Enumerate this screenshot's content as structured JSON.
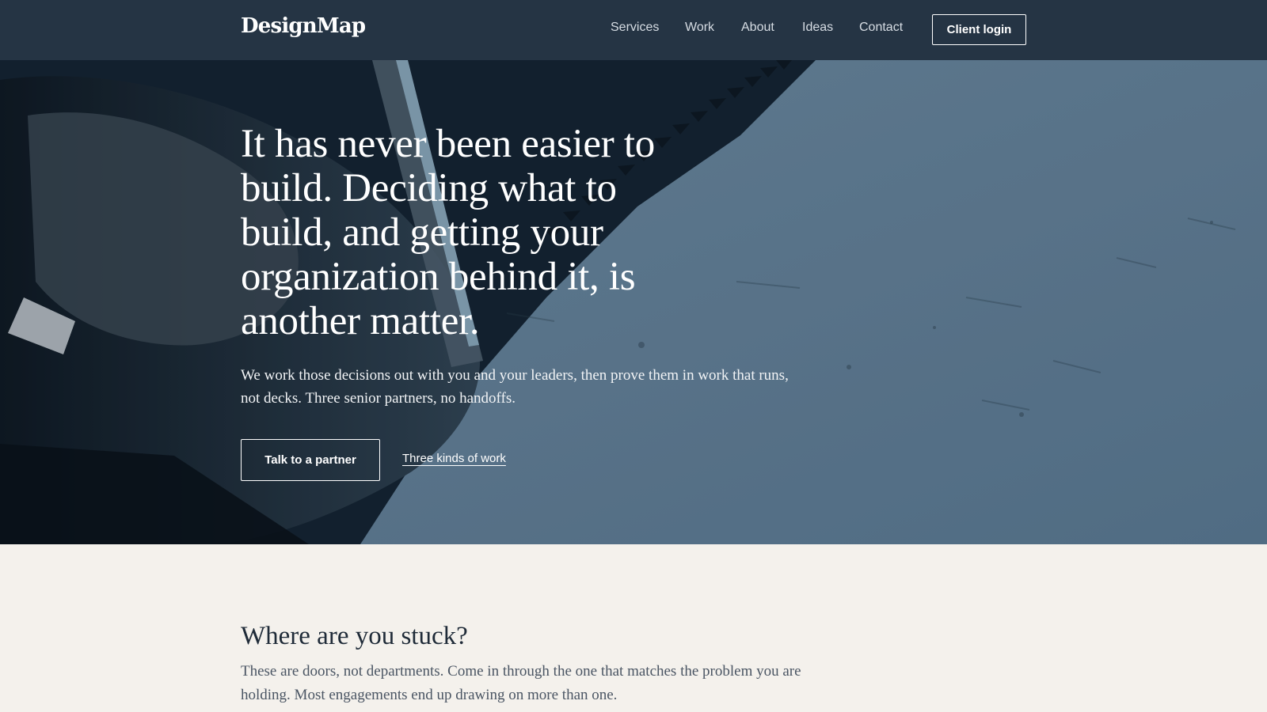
{
  "brand": {
    "logo": "DesignMap"
  },
  "nav": {
    "links": [
      {
        "label": "Services"
      },
      {
        "label": "Work"
      },
      {
        "label": "About"
      },
      {
        "label": "Ideas"
      },
      {
        "label": "Contact"
      }
    ],
    "login_label": "Client login"
  },
  "hero": {
    "headline": "It has never been easier to build. Deciding what to build, and getting your organization behind it, is another matter.",
    "subtext": "We work those decisions out with you and your leaders, then prove them in work that runs, not decks. Three senior partners, no handoffs.",
    "primary_cta": "Talk to a partner",
    "secondary_cta": "Three kinds of work"
  },
  "stuck": {
    "heading": "Where are you stuck?",
    "text": "These are doors, not departments. Come in through the one that matches the problem you are holding. Most engagements end up drawing on more than one."
  },
  "colors": {
    "nav_background": "#253444",
    "hero_blue": "#5f7d96",
    "section_background": "#f4f1ec",
    "heading_text": "#1f2b38"
  }
}
